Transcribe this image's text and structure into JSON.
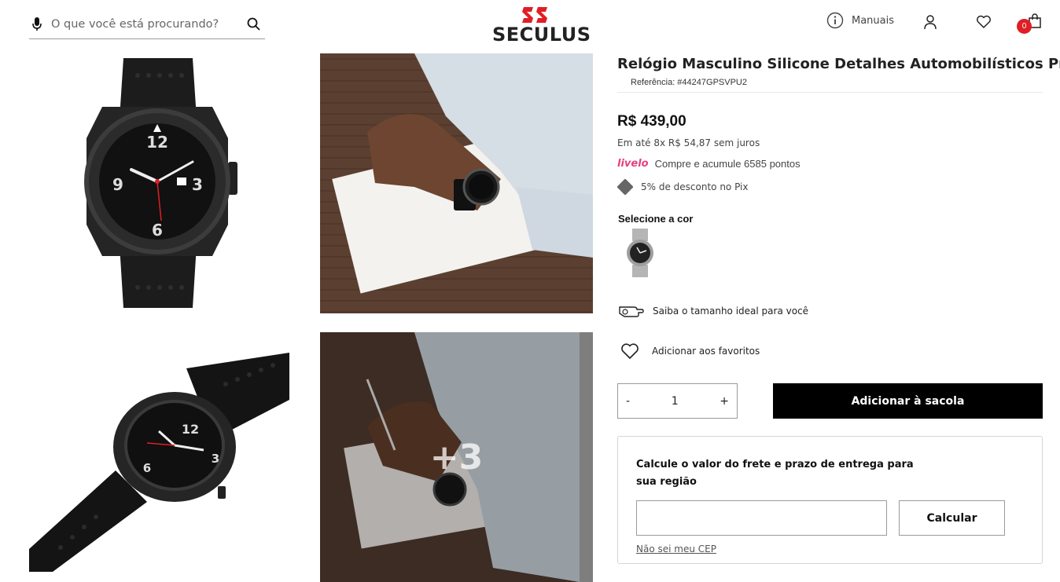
{
  "header": {
    "search_placeholder": "O que você está procurando?",
    "logo_text": "SECULUS",
    "manuals_label": "Manuais",
    "cart_count": "0"
  },
  "gallery": {
    "more_label": "+3"
  },
  "product": {
    "title": "Relógio Masculino Silicone Detalhes Automobilísticos Preto",
    "reference": "Referência: #44247GPSVPU2",
    "price": "R$ 439,00",
    "installments": "Em até 8x R$ 54,87 sem juros",
    "livelo_brand": "livelo",
    "livelo_text": "Compre e acumule 6585 pontos",
    "pix_text": "5% de desconto no Pix",
    "color_label": "Selecione a cor",
    "size_text": "Saiba o tamanho ideal para você",
    "favorite_text": "Adicionar aos favoritos",
    "quantity": "1",
    "qty_minus": "-",
    "qty_plus": "+",
    "add_to_bag": "Adicionar à sacola"
  },
  "shipping": {
    "title": "Calcule o valor do frete e prazo de entrega para sua região",
    "cep_value": "",
    "calculate_label": "Calcular",
    "no_cep_link": "Não sei meu CEP"
  },
  "colors": {
    "brand_red": "#e01e25",
    "livelo_pink": "#e5417f",
    "button_black": "#000000"
  }
}
